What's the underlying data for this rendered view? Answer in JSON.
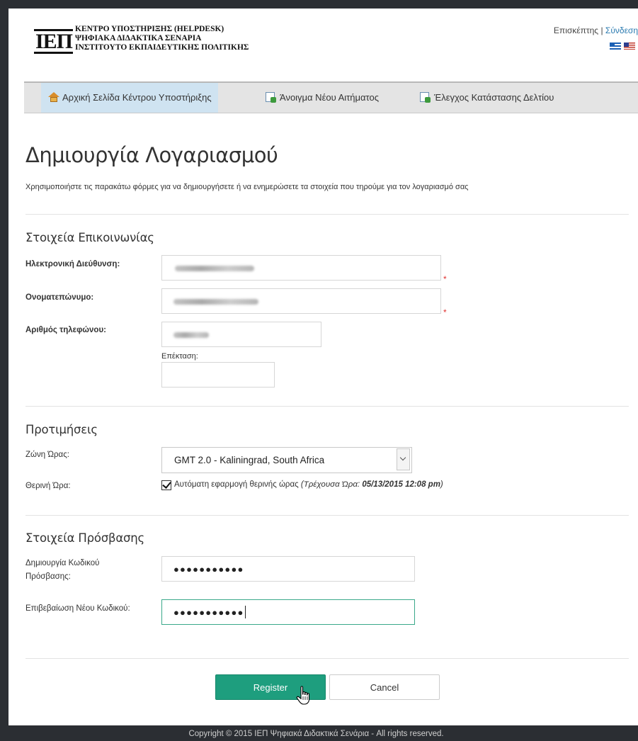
{
  "header": {
    "logo_text": "ΙΕΠ",
    "org_lines": [
      "ΚΕΝΤΡΟ ΥΠΟΣΤΗΡΙΞΗΣ (HELPDESK)",
      "ΨΗΦΙΑΚΑ ΔΙΔΑΚΤΙΚΑ ΣΕΝΑΡΙΑ",
      "ΙΝΣΤΙΤΟΥΤΟ ΕΚΠΑΙΔΕΥΤΙΚΗΣ ΠΟΛΙΤΙΚΗΣ"
    ],
    "guest_label": "Επισκέπτης",
    "separator": "|",
    "login_link": "Σύνδεση",
    "flags": [
      "greek-flag-icon",
      "us-flag-icon"
    ]
  },
  "nav": {
    "items": [
      {
        "label": "Αρχική Σελίδα Κέντρου Υποστήριξης",
        "icon": "home-icon",
        "active": true
      },
      {
        "label": "Άνοιγμα Νέου Αιτήματος",
        "icon": "new-ticket-icon",
        "active": false
      },
      {
        "label": "Έλεγχος Κατάστασης Δελτίου",
        "icon": "ticket-status-icon",
        "active": false
      }
    ]
  },
  "page": {
    "title": "Δημιουργία Λογαριασμού",
    "subtitle": "Χρησιμοποιήστε τις παρακάτω φόρμες για να δημιουργήσετε ή να ενημερώσετε τα στοιχεία που τηρούμε για τον λογαριασμό σας"
  },
  "contact": {
    "section_title": "Στοιχεία Επικοινωνίας",
    "email_label": "Ηλεκτρονική Διεύθυνση:",
    "name_label": "Ονοματεπώνυμο:",
    "phone_label": "Αριθμός τηλεφώνου:",
    "extension_label": "Επέκταση:",
    "required_mark": "*"
  },
  "preferences": {
    "section_title": "Προτιμήσεις",
    "timezone_label": "Ζώνη Ώρας:",
    "timezone_value": "GMT 2.0 - Kaliningrad, South Africa",
    "dst_label": "Θερινή Ώρα:",
    "dst_checked": true,
    "dst_text": "Αυτόματη εφαρμογή θερινής ώρας",
    "current_time_prefix": "(Τρέχουσα Ώρα:",
    "current_time_value": "05/13/2015 12:08 pm",
    "current_time_suffix": ")"
  },
  "access": {
    "section_title": "Στοιχεία Πρόσβασης",
    "password_label_line1": "Δημιουργία Κωδικού",
    "password_label_line2": "Πρόσβασης:",
    "password_mask": "●●●●●●●●●●●",
    "confirm_label": "Επιβεβαίωση Νέου Κωδικού:",
    "confirm_mask": "●●●●●●●●●●●"
  },
  "buttons": {
    "register": "Register",
    "cancel": "Cancel"
  },
  "footer": {
    "text": "Copyright © 2015 ΙΕΠ Ψηφιακά Διδακτικά Σενάρια - All rights reserved."
  },
  "colors": {
    "primary": "#1e9e7e",
    "link": "#2a7ab0",
    "required": "#e0312f",
    "active_nav": "#cfe3f1",
    "focus_border": "#3aa98a"
  }
}
